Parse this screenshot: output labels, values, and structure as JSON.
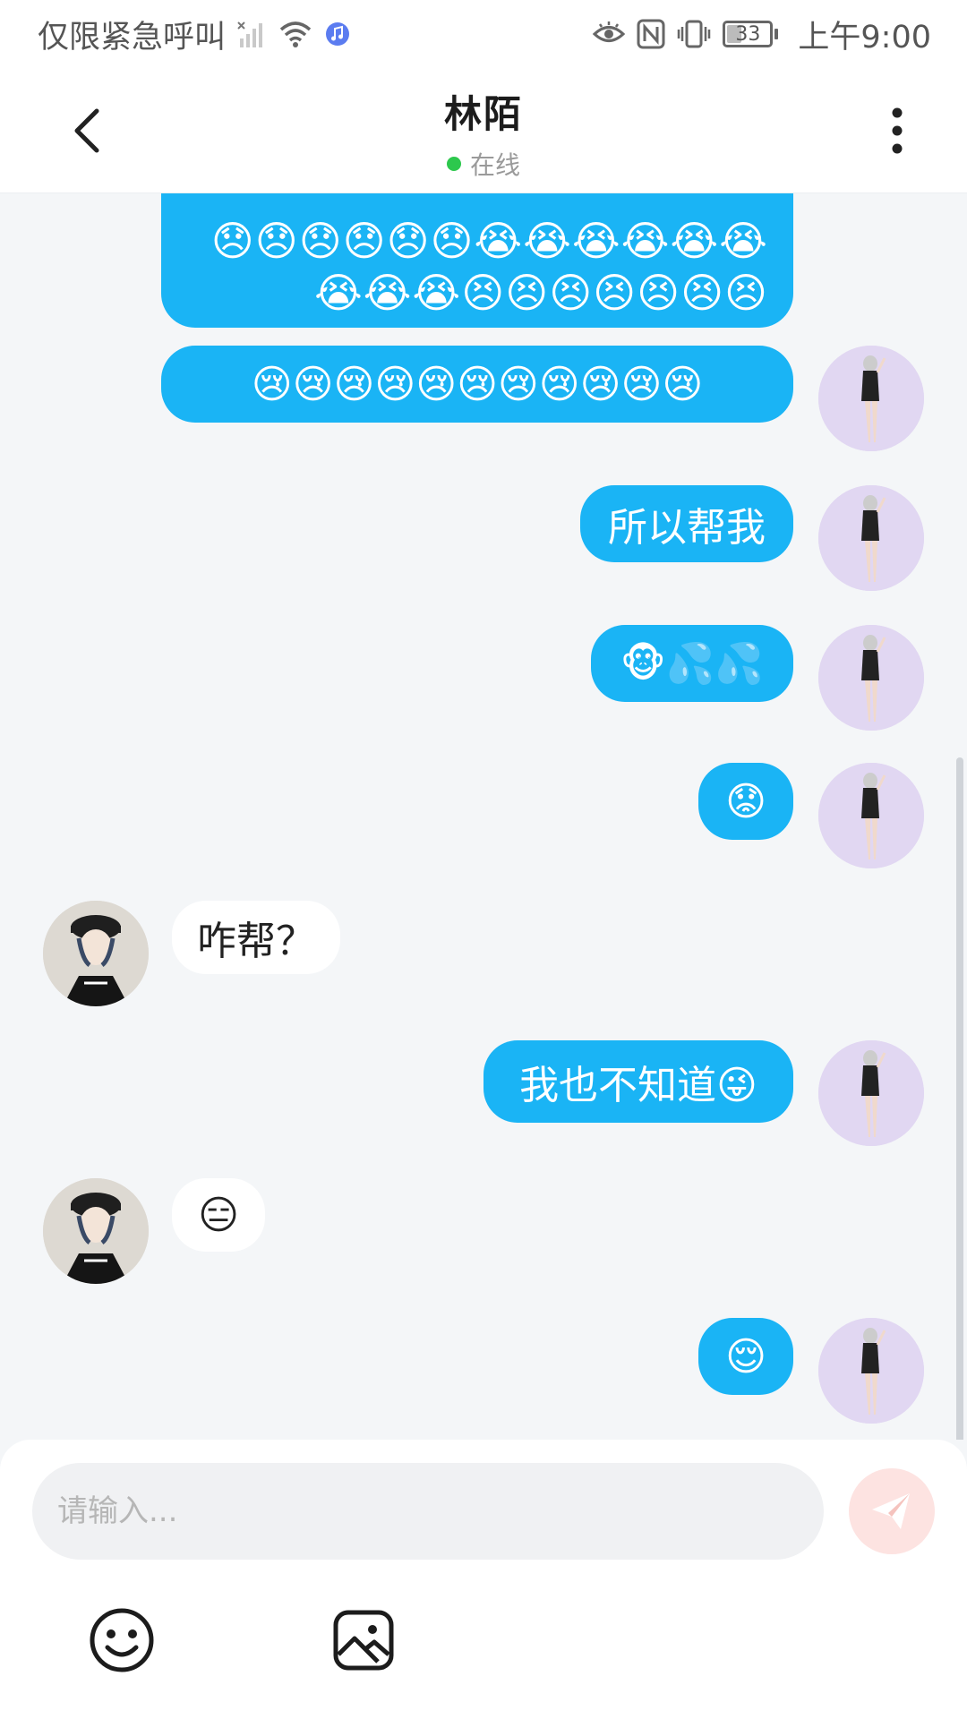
{
  "status_bar": {
    "carrier": "仅限紧急呼叫",
    "battery": "33",
    "time": "上午9:00"
  },
  "header": {
    "title": "林陌",
    "presence": "在线"
  },
  "messages": [
    {
      "from": "me",
      "text": "😞😞😞😞😞😞😭😭😭😭😭😭😭😭😭😣😣😣😣😣😣😣"
    },
    {
      "from": "me",
      "text": "😢😢😢😢😢😢😢😢😢😢😢"
    },
    {
      "from": "me",
      "text": "所以帮我"
    },
    {
      "from": "me",
      "text": "🐵💦💦"
    },
    {
      "from": "me",
      "text": "😟"
    },
    {
      "from": "other",
      "text": "咋帮？"
    },
    {
      "from": "me",
      "text": "我也不知道😜"
    },
    {
      "from": "other",
      "text": "😑"
    },
    {
      "from": "me",
      "text": "😌"
    }
  ],
  "input": {
    "placeholder": "请输入..."
  },
  "icons": {
    "back": "back-arrow-icon",
    "more": "more-vertical-icon",
    "send": "send-icon",
    "emoji": "emoji-icon",
    "image": "image-icon"
  },
  "colors": {
    "outgoing_bubble": "#1ab4f5",
    "incoming_bubble": "#ffffff",
    "online_dot": "#2dc84d",
    "send_button": "#fde3e1"
  }
}
